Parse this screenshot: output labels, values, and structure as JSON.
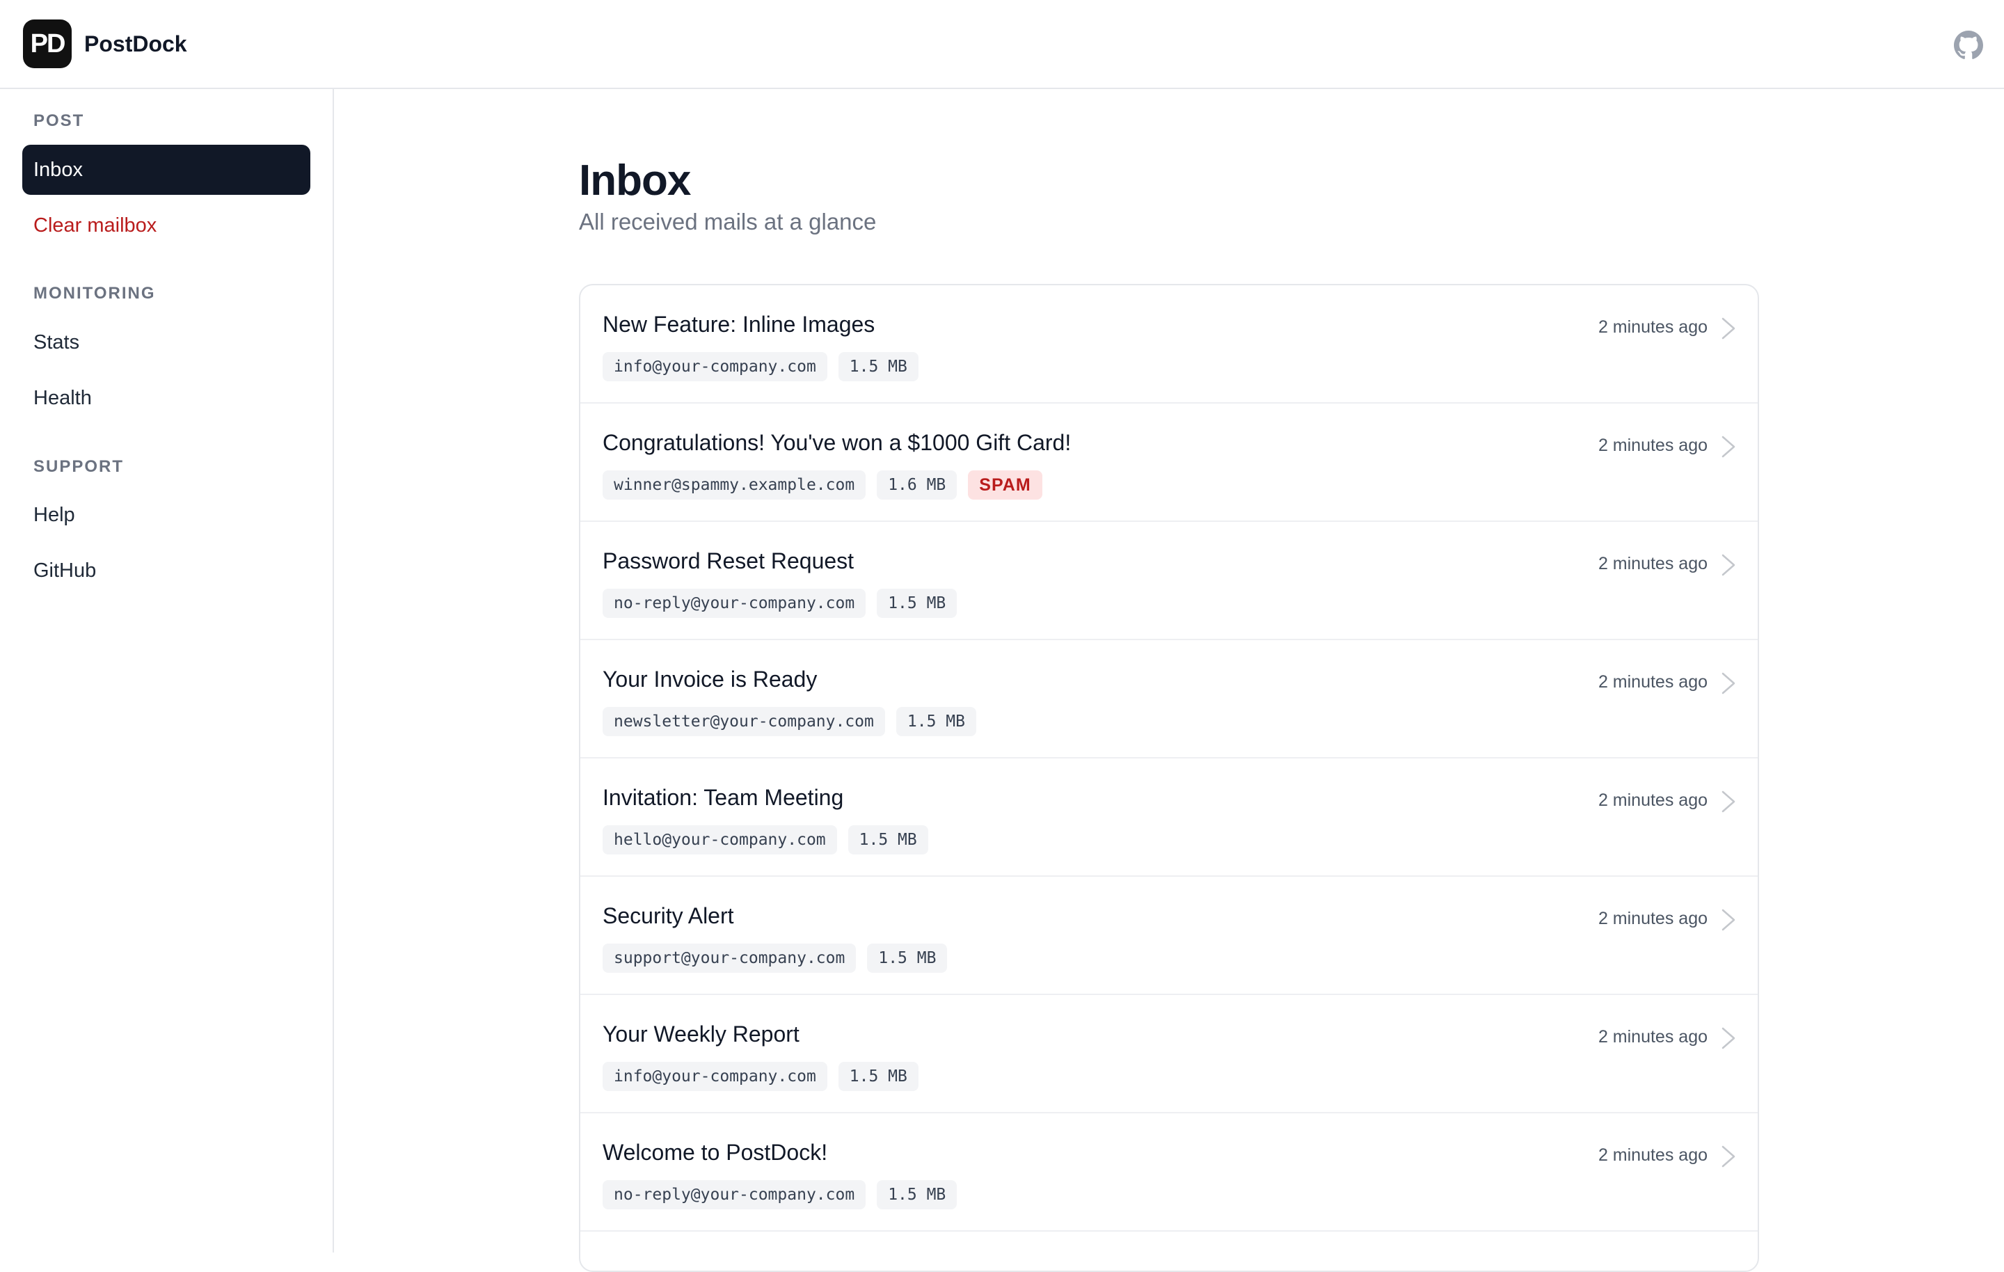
{
  "header": {
    "logo_text": "PD",
    "app_name": "PostDock",
    "github_icon": "github-icon"
  },
  "sidebar": {
    "sections": [
      {
        "title": "POST",
        "items": [
          {
            "label": "Inbox",
            "active": true
          },
          {
            "label": "Clear mailbox",
            "danger": true
          }
        ]
      },
      {
        "title": "MONITORING",
        "items": [
          {
            "label": "Stats"
          },
          {
            "label": "Health"
          }
        ]
      },
      {
        "title": "SUPPORT",
        "items": [
          {
            "label": "Help"
          },
          {
            "label": "GitHub"
          }
        ]
      }
    ]
  },
  "main": {
    "title": "Inbox",
    "subtitle": "All received mails at a glance",
    "mails": [
      {
        "subject": "New Feature: Inline Images",
        "from": "info@your-company.com",
        "size": "1.5 MB",
        "time": "2 minutes ago"
      },
      {
        "subject": "Congratulations! You've won a $1000 Gift Card!",
        "from": "winner@spammy.example.com",
        "size": "1.6 MB",
        "spam": "SPAM",
        "time": "2 minutes ago"
      },
      {
        "subject": "Password Reset Request",
        "from": "no-reply@your-company.com",
        "size": "1.5 MB",
        "time": "2 minutes ago"
      },
      {
        "subject": "Your Invoice is Ready",
        "from": "newsletter@your-company.com",
        "size": "1.5 MB",
        "time": "2 minutes ago"
      },
      {
        "subject": "Invitation: Team Meeting",
        "from": "hello@your-company.com",
        "size": "1.5 MB",
        "time": "2 minutes ago"
      },
      {
        "subject": "Security Alert",
        "from": "support@your-company.com",
        "size": "1.5 MB",
        "time": "2 minutes ago"
      },
      {
        "subject": "Your Weekly Report",
        "from": "info@your-company.com",
        "size": "1.5 MB",
        "time": "2 minutes ago"
      },
      {
        "subject": "Welcome to PostDock!",
        "from": "no-reply@your-company.com",
        "size": "1.5 MB",
        "time": "2 minutes ago"
      }
    ]
  },
  "colors": {
    "active_nav_bg": "#111827",
    "danger": "#b91c1c",
    "spam_bg": "#fde2e2",
    "border": "#e5e7eb"
  }
}
